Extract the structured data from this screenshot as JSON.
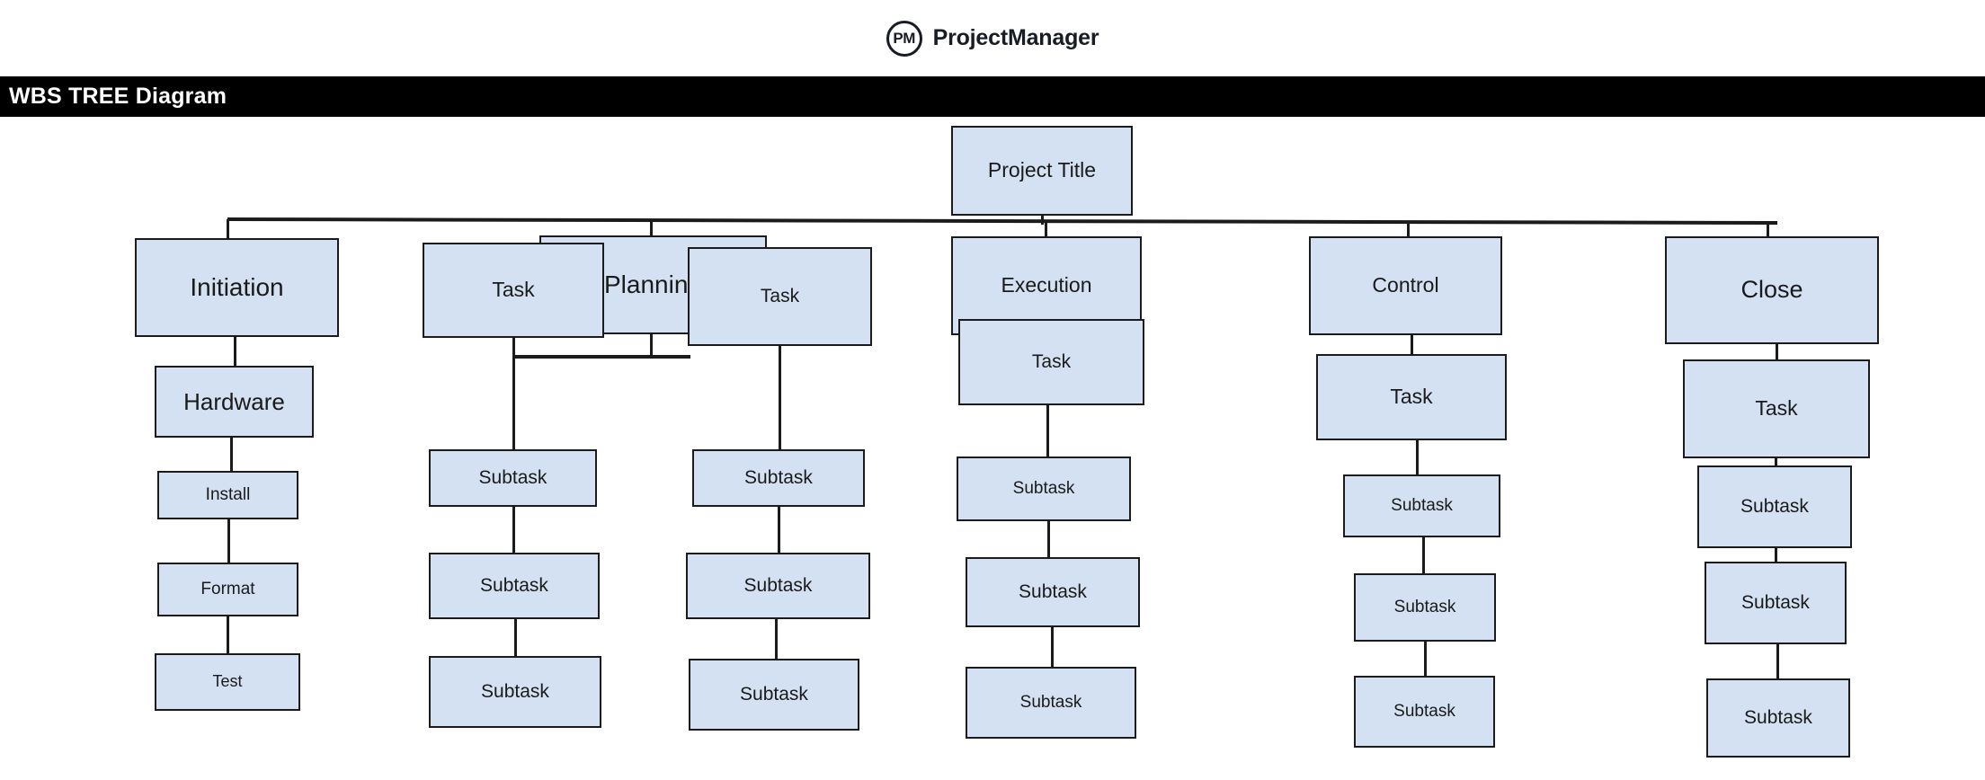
{
  "brand": {
    "mark_text": "PM",
    "name": "ProjectManager",
    "mark_icon": "pm-circle-logo"
  },
  "title_bar": {
    "text": "WBS TREE Diagram",
    "background": "#000000",
    "foreground": "#ffffff"
  },
  "theme": {
    "node_fill": "#d4e1f2",
    "node_border": "#1b1b1b",
    "connector": "#1b1b1b",
    "canvas": "#ffffff"
  },
  "diagram": {
    "type": "wbs-tree",
    "root": {
      "label": "Project Title"
    },
    "branches": [
      {
        "label": "Initiation",
        "columns": [
          {
            "nodes": [
              {
                "label": "Hardware"
              },
              {
                "label": "Install"
              },
              {
                "label": "Format"
              },
              {
                "label": "Test"
              }
            ]
          }
        ]
      },
      {
        "label": "Planning",
        "columns": [
          {
            "nodes": [
              {
                "label": "Task"
              },
              {
                "label": "Subtask"
              },
              {
                "label": "Subtask"
              },
              {
                "label": "Subtask"
              }
            ]
          },
          {
            "nodes": [
              {
                "label": "Task"
              },
              {
                "label": "Subtask"
              },
              {
                "label": "Subtask"
              },
              {
                "label": "Subtask"
              }
            ]
          }
        ]
      },
      {
        "label": "Execution",
        "columns": [
          {
            "nodes": [
              {
                "label": "Task"
              },
              {
                "label": "Subtask"
              },
              {
                "label": "Subtask"
              },
              {
                "label": "Subtask"
              }
            ]
          }
        ]
      },
      {
        "label": "Control",
        "columns": [
          {
            "nodes": [
              {
                "label": "Task"
              },
              {
                "label": "Subtask"
              },
              {
                "label": "Subtask"
              },
              {
                "label": "Subtask"
              }
            ]
          }
        ]
      },
      {
        "label": "Close",
        "columns": [
          {
            "nodes": [
              {
                "label": "Task"
              },
              {
                "label": "Subtask"
              },
              {
                "label": "Subtask"
              },
              {
                "label": "Subtask"
              }
            ]
          }
        ]
      }
    ]
  }
}
